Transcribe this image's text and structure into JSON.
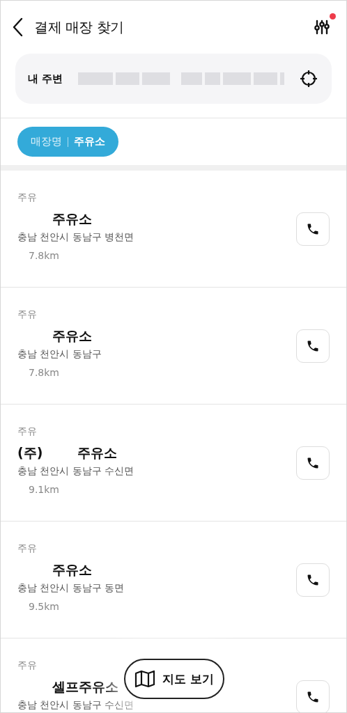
{
  "header": {
    "title": "결제 매장 찾기",
    "filter_badge": true
  },
  "location": {
    "label": "내 주변"
  },
  "filter_chip": {
    "label": "매장명",
    "value": "주유소"
  },
  "stores": [
    {
      "category": "주유",
      "name": "주유소",
      "address": "충남 천안시 동남구 병천면",
      "distance": "7.8km"
    },
    {
      "category": "주유",
      "name": "주유소",
      "address": "충남 천안시 동남구",
      "distance": "7.8km"
    },
    {
      "category": "주유",
      "prefix": "(주)",
      "name": "주유소",
      "address": "충남 천안시 동남구 수신면",
      "distance": "9.1km"
    },
    {
      "category": "주유",
      "name": "주유소",
      "address": "충남 천안시 동남구 동면",
      "distance": "9.5km"
    },
    {
      "category": "주유",
      "name": "셀프주유소",
      "address": "충남 천안시 동남구 수신면"
    }
  ],
  "map_button": {
    "label": "지도 보기"
  }
}
